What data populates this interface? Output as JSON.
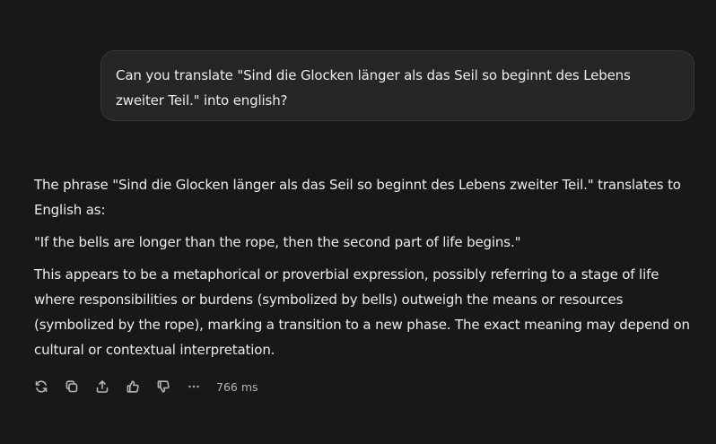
{
  "conversation": {
    "user_message": "Can you translate \"Sind die Glocken länger als das Seil so beginnt des Lebens zweiter Teil.\" into english?",
    "assistant": {
      "paragraphs": [
        "The phrase \"Sind die Glocken länger als das Seil so beginnt des Lebens zweiter Teil.\" translates to English as:",
        "\"If the bells are longer than the rope, then the second part of life begins.\"",
        "This appears to be a metaphorical or proverbial expression, possibly referring to a stage of life where responsibilities or burdens (symbolized by bells) outweigh the means or resources (symbolized by the rope), marking a transition to a new phase. The exact meaning may depend on cultural or contextual interpretation."
      ]
    }
  },
  "actions": {
    "icons": [
      "regenerate-icon",
      "copy-icon",
      "share-icon",
      "thumbs-up-icon",
      "thumbs-down-icon",
      "more-icon"
    ],
    "latency": "766 ms"
  }
}
